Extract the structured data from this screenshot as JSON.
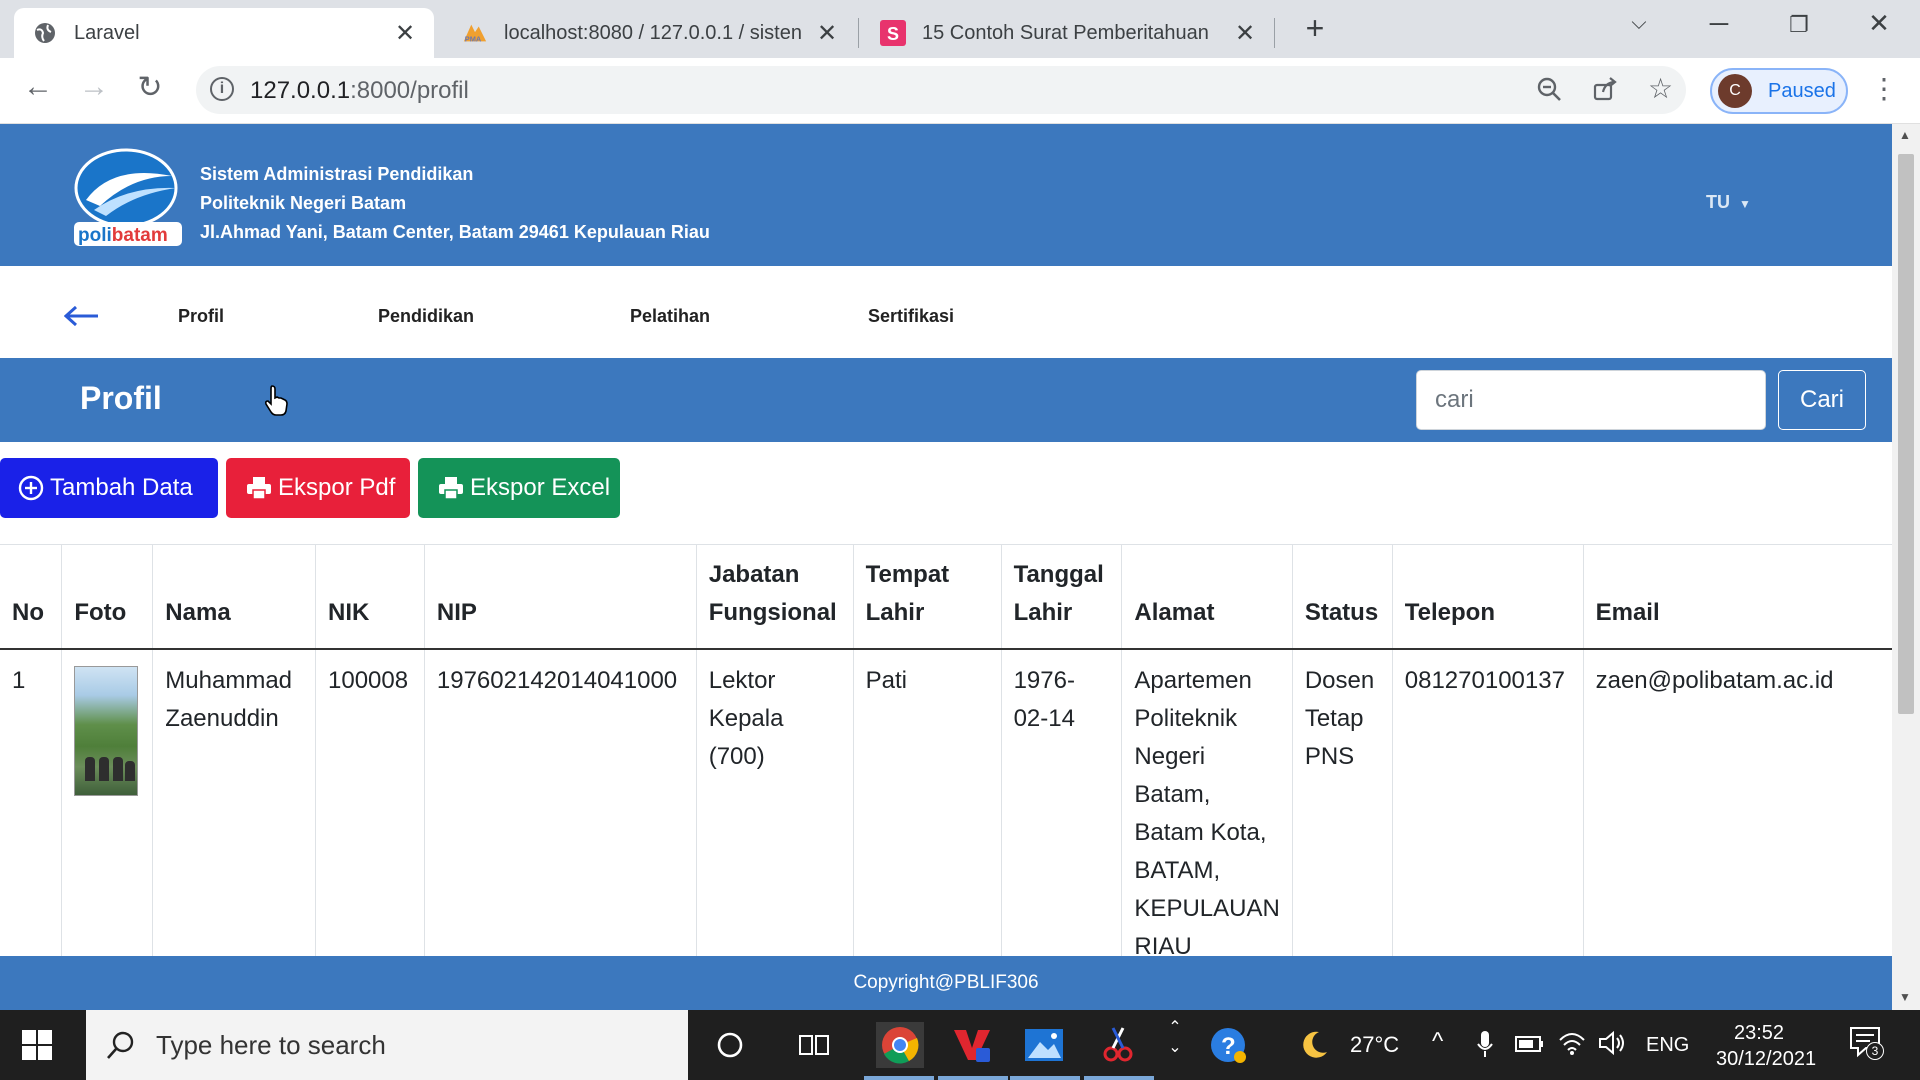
{
  "browser": {
    "tabs": [
      {
        "title": "Laravel",
        "active": true
      },
      {
        "title": "localhost:8080 / 127.0.0.1 / sisten",
        "active": false
      },
      {
        "title": "15 Contoh Surat Pemberitahuan",
        "active": false
      }
    ],
    "url_host": "127.0.0.1",
    "url_rest": ":8000/profil",
    "profile_initial": "C",
    "profile_label": "Paused"
  },
  "header": {
    "line1": "Sistem Administrasi Pendidikan",
    "line2": "Politeknik Negeri Batam",
    "line3": "Jl.Ahmad Yani, Batam Center, Batam 29461 Kepulauan Riau",
    "logo_text": "polibatam",
    "user_menu": "TU"
  },
  "subnav": {
    "items": [
      "Profil",
      "Pendidikan",
      "Pelatihan",
      "Sertifikasi"
    ]
  },
  "profil_bar": {
    "title": "Profil",
    "search_placeholder": "cari",
    "search_button": "Cari"
  },
  "actions": {
    "add": "Tambah Data",
    "pdf": "Ekspor Pdf",
    "excel": "Ekspor Excel"
  },
  "table": {
    "headers": [
      "No",
      "Foto",
      "Nama",
      "NIK",
      "NIP",
      "Jabatan Fungsional",
      "Tempat Lahir",
      "Tanggal Lahir",
      "Alamat",
      "Status",
      "Telepon",
      "Email"
    ],
    "rows": [
      {
        "no": "1",
        "nama": "Muhammad Zaenuddin",
        "nik": "100008",
        "nip": "197602142014041000",
        "jabatan": "Lektor Kepala (700)",
        "tempat": "Pati",
        "tanggal": "1976-02-14",
        "alamat": "Apartemen Politeknik Negeri Batam, Batam Kota, BATAM, KEPULAUAN RIAU",
        "status": "Dosen Tetap PNS",
        "telepon": "081270100137",
        "email": "zaen@polibatam.ac.id"
      }
    ]
  },
  "footer": "Copyright@PBLIF306",
  "taskbar": {
    "search_text": "Type here to search",
    "weather": "27°C",
    "language": "ENG",
    "time": "23:52",
    "date": "30/12/2021",
    "notif_count": "3"
  },
  "colors": {
    "primary": "#3c78be",
    "btn_blue": "#1a21e8",
    "btn_red": "#e8203a",
    "btn_green": "#149358"
  }
}
